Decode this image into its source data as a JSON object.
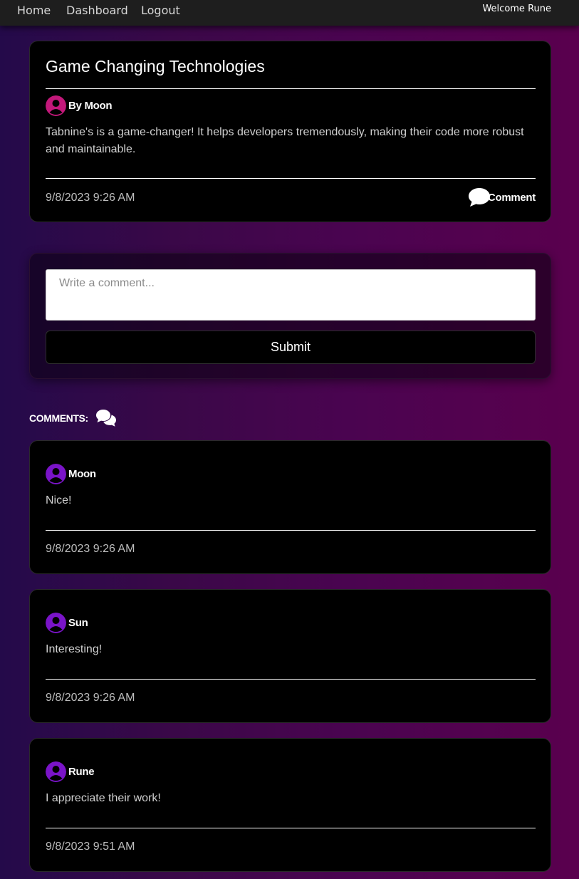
{
  "nav": {
    "home": "Home",
    "dashboard": "Dashboard",
    "logout": "Logout",
    "welcome": "Welcome Rune"
  },
  "post": {
    "title": "Game Changing Technologies",
    "author": "By Moon",
    "body": "Tabnine's is a game-changer! It helps developers tremendously, making their code more robust and maintainable.",
    "timestamp": "9/8/2023 9:26 AM",
    "comment_label": "Comment",
    "avatar_color": "#c2187a"
  },
  "form": {
    "placeholder": "Write a comment...",
    "submit_label": "Submit"
  },
  "comments_heading": "COMMENTS:",
  "comments": [
    {
      "author": "Moon",
      "text": "Nice!",
      "timestamp": "9/8/2023 9:26 AM"
    },
    {
      "author": "Sun",
      "text": "Interesting!",
      "timestamp": "9/8/2023 9:26 AM"
    },
    {
      "author": "Rune",
      "text": "I appreciate their work!",
      "timestamp": "9/8/2023 9:51 AM"
    }
  ],
  "comment_avatar_color": "#7a14c8",
  "icons": {
    "user": "user-circle-icon",
    "comment": "speech-bubble-icon",
    "comments": "comments-icon"
  }
}
